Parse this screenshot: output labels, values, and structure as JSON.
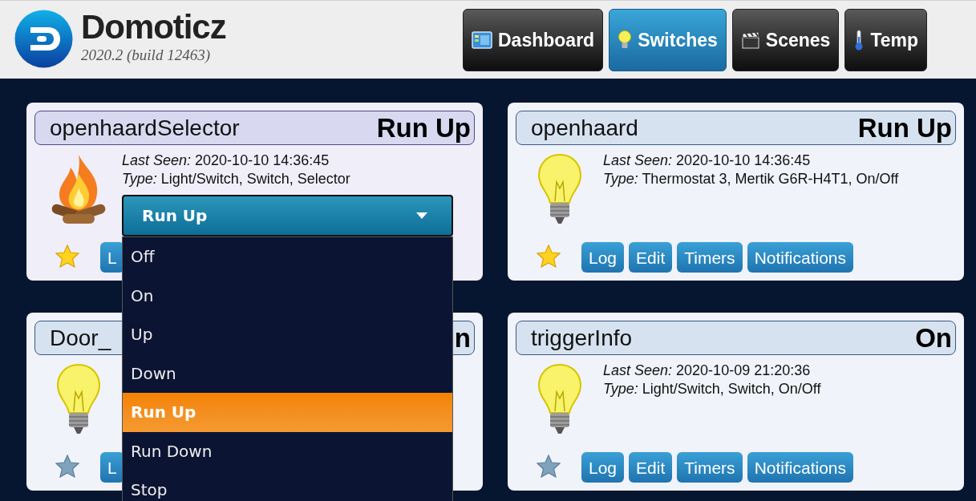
{
  "header": {
    "logo": {
      "title": "Domoticz",
      "version": "2020.2 (build 12463)"
    },
    "tabs": [
      {
        "label": "Dashboard",
        "selected": false,
        "kind": "dashboard"
      },
      {
        "label": "Switches",
        "selected": true,
        "kind": "bulb"
      },
      {
        "label": "Scenes",
        "selected": false,
        "kind": "scenes"
      },
      {
        "label": "Temp",
        "selected": false,
        "kind": "thermometer"
      }
    ]
  },
  "devices": [
    {
      "name": "openhaardSelector",
      "status": "Run Up",
      "highlighted": true,
      "kind": "fire",
      "favorite": true,
      "last_seen_label": "Last Seen:",
      "last_seen": "2020-10-10 14:36:45",
      "type_label": "Type:",
      "type": "Light/Switch, Switch, Selector",
      "buttons": [
        "L"
      ]
    },
    {
      "name": "openhaard",
      "status": "Run Up",
      "highlighted": false,
      "kind": "bulb",
      "favorite": true,
      "last_seen_label": "Last Seen:",
      "last_seen": "2020-10-10 14:36:45",
      "type_label": "Type:",
      "type": "Thermostat 3, Mertik G6R-H4T1, On/Off",
      "buttons": [
        "Log",
        "Edit",
        "Timers",
        "Notifications"
      ]
    },
    {
      "name": "Door_",
      "status": "n",
      "highlighted": false,
      "kind": "bulb",
      "favorite": false,
      "buttons": [
        "L"
      ]
    },
    {
      "name": "triggerInfo",
      "status": "On",
      "highlighted": false,
      "kind": "bulb",
      "favorite": false,
      "last_seen_label": "Last Seen:",
      "last_seen": "2020-10-09 21:20:36",
      "type_label": "Type:",
      "type": "Light/Switch, Switch, On/Off",
      "buttons": [
        "Log",
        "Edit",
        "Timers",
        "Notifications"
      ]
    }
  ],
  "selector_dropdown": {
    "value": "Run Up",
    "options": [
      {
        "label": "Off",
        "selected": false
      },
      {
        "label": "On",
        "selected": false
      },
      {
        "label": "Up",
        "selected": false
      },
      {
        "label": "Down",
        "selected": false
      },
      {
        "label": "Run Up",
        "selected": true
      },
      {
        "label": "Run Down",
        "selected": false
      },
      {
        "label": "Stop",
        "selected": false
      }
    ]
  }
}
